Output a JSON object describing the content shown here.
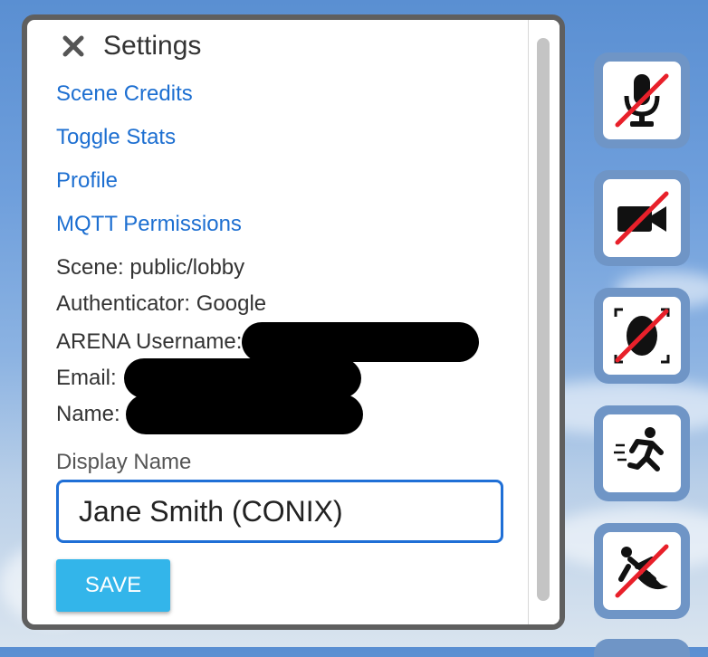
{
  "settings": {
    "title": "Settings",
    "links": {
      "scene_credits": "Scene Credits",
      "toggle_stats": "Toggle Stats",
      "profile": "Profile",
      "mqtt_permissions": "MQTT Permissions"
    },
    "info": {
      "scene": "Scene: public/lobby",
      "authenticator": "Authenticator: Google",
      "arena_username_label": "ARENA Username:",
      "email_label": "Email:",
      "name_label": "Name:"
    },
    "display_name": {
      "label": "Display Name",
      "value": "Jane Smith (CONIX)"
    },
    "save_label": "SAVE"
  },
  "toolbar": {
    "buttons": [
      {
        "icon": "microphone-off-icon",
        "state": "off"
      },
      {
        "icon": "video-off-icon",
        "state": "off"
      },
      {
        "icon": "face-tracking-off-icon",
        "state": "off"
      },
      {
        "icon": "running-person-icon",
        "state": "on"
      },
      {
        "icon": "flying-off-icon",
        "state": "off"
      }
    ],
    "accent": "#6f95c6",
    "off_slash_color": "#e8202a"
  }
}
